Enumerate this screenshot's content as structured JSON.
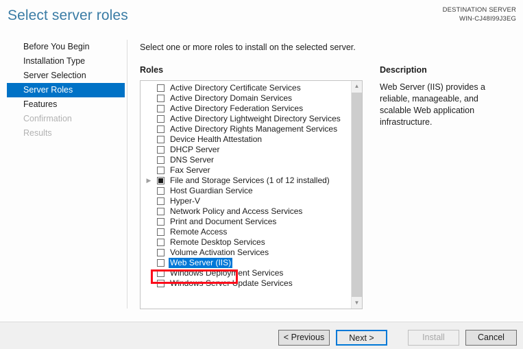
{
  "header": {
    "title": "Select server roles",
    "destination_label": "DESTINATION SERVER",
    "destination_server": "WIN-CJ48I99J3EG"
  },
  "sidebar": {
    "items": [
      {
        "label": "Before You Begin",
        "state": "normal"
      },
      {
        "label": "Installation Type",
        "state": "normal"
      },
      {
        "label": "Server Selection",
        "state": "normal"
      },
      {
        "label": "Server Roles",
        "state": "active"
      },
      {
        "label": "Features",
        "state": "normal"
      },
      {
        "label": "Confirmation",
        "state": "disabled"
      },
      {
        "label": "Results",
        "state": "disabled"
      }
    ]
  },
  "main": {
    "instruction": "Select one or more roles to install on the selected server.",
    "roles_label": "Roles",
    "roles": [
      {
        "label": "Active Directory Certificate Services",
        "checked": "unchecked",
        "expandable": false,
        "selected": false
      },
      {
        "label": "Active Directory Domain Services",
        "checked": "unchecked",
        "expandable": false,
        "selected": false
      },
      {
        "label": "Active Directory Federation Services",
        "checked": "unchecked",
        "expandable": false,
        "selected": false
      },
      {
        "label": "Active Directory Lightweight Directory Services",
        "checked": "unchecked",
        "expandable": false,
        "selected": false
      },
      {
        "label": "Active Directory Rights Management Services",
        "checked": "unchecked",
        "expandable": false,
        "selected": false
      },
      {
        "label": "Device Health Attestation",
        "checked": "unchecked",
        "expandable": false,
        "selected": false
      },
      {
        "label": "DHCP Server",
        "checked": "unchecked",
        "expandable": false,
        "selected": false
      },
      {
        "label": "DNS Server",
        "checked": "unchecked",
        "expandable": false,
        "selected": false
      },
      {
        "label": "Fax Server",
        "checked": "unchecked",
        "expandable": false,
        "selected": false
      },
      {
        "label": "File and Storage Services (1 of 12 installed)",
        "checked": "partial",
        "expandable": true,
        "selected": false
      },
      {
        "label": "Host Guardian Service",
        "checked": "unchecked",
        "expandable": false,
        "selected": false
      },
      {
        "label": "Hyper-V",
        "checked": "unchecked",
        "expandable": false,
        "selected": false
      },
      {
        "label": "Network Policy and Access Services",
        "checked": "unchecked",
        "expandable": false,
        "selected": false
      },
      {
        "label": "Print and Document Services",
        "checked": "unchecked",
        "expandable": false,
        "selected": false
      },
      {
        "label": "Remote Access",
        "checked": "unchecked",
        "expandable": false,
        "selected": false
      },
      {
        "label": "Remote Desktop Services",
        "checked": "unchecked",
        "expandable": false,
        "selected": false
      },
      {
        "label": "Volume Activation Services",
        "checked": "unchecked",
        "expandable": false,
        "selected": false
      },
      {
        "label": "Web Server (IIS)",
        "checked": "unchecked",
        "expandable": false,
        "selected": true
      },
      {
        "label": "Windows Deployment Services",
        "checked": "unchecked",
        "expandable": false,
        "selected": false
      },
      {
        "label": "Windows Server Update Services",
        "checked": "unchecked",
        "expandable": false,
        "selected": false
      }
    ],
    "scroll_up_icon": "chevron-up-icon",
    "scroll_down_icon": "chevron-down-icon",
    "expander_icon": "triangle-right-icon"
  },
  "description": {
    "title": "Description",
    "body": "Web Server (IIS) provides a reliable, manageable, and scalable Web application infrastructure."
  },
  "footer": {
    "previous_label": "< Previous",
    "next_label": "Next >",
    "install_label": "Install",
    "cancel_label": "Cancel"
  },
  "colors": {
    "title_blue": "#3a7ca5",
    "nav_active_blue": "#0072c6",
    "selection_blue": "#0078d7",
    "annotation_red": "#fc0d1b",
    "footer_background": "#f0f0f0"
  }
}
